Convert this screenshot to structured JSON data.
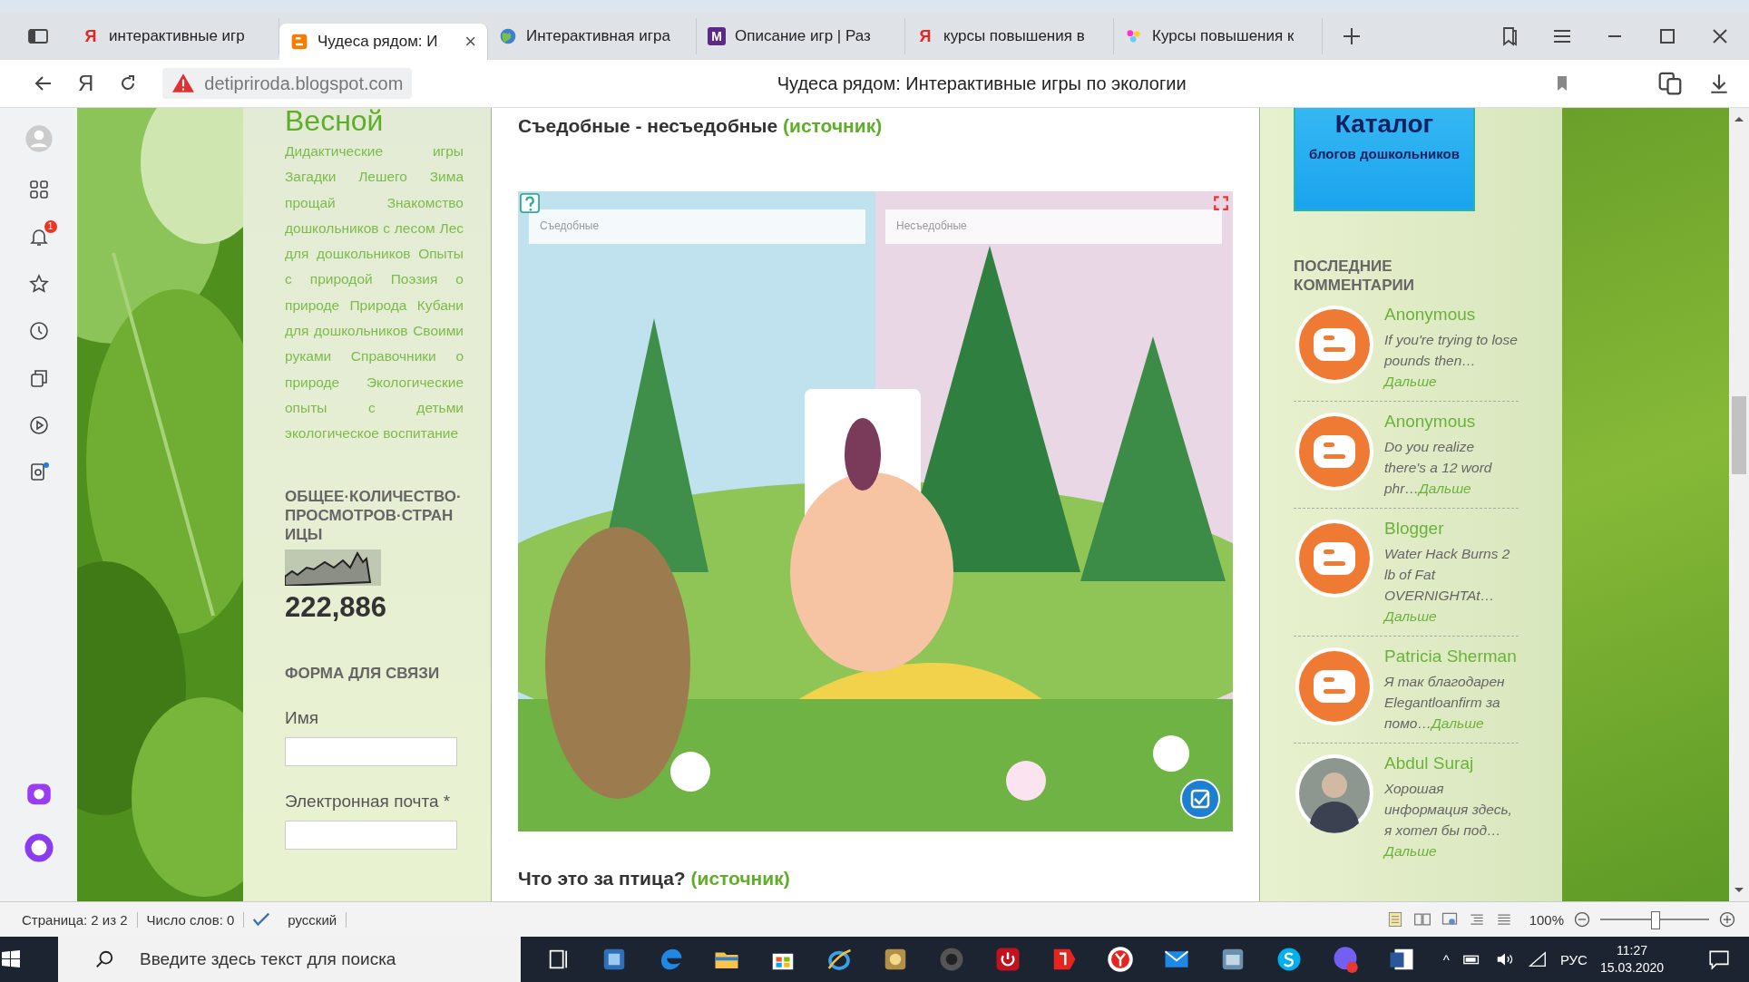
{
  "browser": {
    "tabs": [
      {
        "title": "интерактивные игр",
        "favicon": {
          "kind": "letter",
          "text": "Я",
          "color": "#e52620"
        },
        "selected": false
      },
      {
        "title": "Чудеса рядом: И",
        "favicon": {
          "kind": "blogger"
        },
        "selected": true
      },
      {
        "title": "Интерактивная игра",
        "favicon": {
          "kind": "globe"
        },
        "selected": false
      },
      {
        "title": "Описание игр | Раз",
        "favicon": {
          "kind": "tile",
          "text": "M",
          "color": "#5b2a86"
        },
        "selected": false
      },
      {
        "title": "курсы повышения в",
        "favicon": {
          "kind": "letter",
          "text": "Я",
          "color": "#e52620"
        },
        "selected": false
      },
      {
        "title": "Курсы повышения к",
        "favicon": {
          "kind": "flowers"
        },
        "selected": false
      }
    ],
    "tab_close": "×",
    "address_bar": {
      "home_button": "Я",
      "url": "detipriroda.blogspot.com",
      "page_title": "Чудеса рядом: Интерактивные игры по экологии"
    },
    "sidebar_badge": "1"
  },
  "left_column": {
    "title_tail": "Весной",
    "tags": "Дидактические игры Загадки Лешего Зима прощай Знакомство дошкольников с лесом Лес для дошкольников Опыты с природой Поэзия о природе Природа Кубани для дошкольников Своими руками Справочники о природе Экологические опыты с детьми экологическое воспитание",
    "stats_heading": "ОБЩЕЕ·КОЛИЧЕСТВО·ПРОСМОТРОВ·СТРАНИЦЫ",
    "views": "222,886",
    "form_heading": "ФОРМА ДЛЯ СВЯЗИ",
    "fields": [
      {
        "label": "Имя"
      },
      {
        "label": "Электронная почта *"
      }
    ]
  },
  "main": {
    "post_title": "Съедобные - несъедобные",
    "source_link": "(источник)",
    "game": {
      "zones": [
        "Съедобные",
        "Несъедобные"
      ]
    },
    "next_title": "Что это за птица?",
    "next_source_link": "(источник)"
  },
  "right_column": {
    "banner": {
      "title": "Каталог",
      "subtitle": "блогов дошкольников"
    },
    "comments_heading": "ПОСЛЕДНИЕ КОММЕНТАРИИ",
    "comments": [
      {
        "author": "Anonymous",
        "kind": "blogger",
        "text": "If you're trying to lose pounds then…",
        "more": "Дальше"
      },
      {
        "author": "Anonymous",
        "kind": "blogger",
        "text": "Do you realize there's a 12 word phr…",
        "more": "Дальше"
      },
      {
        "author": "Blogger",
        "kind": "blogger",
        "text": "Water Hack Burns 2 lb of Fat OVERNIGHTAt…",
        "more": "Дальше"
      },
      {
        "author": "Patricia Sherman",
        "kind": "blogger",
        "text": "Я так благодарен Elegantloanfirm за помо…",
        "more": "Дальше"
      },
      {
        "author": "Abdul Suraj",
        "text": "Хорошая информация здесь, я хотел бы под…",
        "more": "Дальше"
      }
    ]
  },
  "status_bar": {
    "page": "Страница: 2 из 2",
    "words": "Число слов: 0",
    "language": "русский",
    "zoom": "100%",
    "zoom_slider": {
      "level": 0.5
    }
  },
  "taskbar": {
    "search_placeholder": "Введите здесь текст для поиска",
    "language": "РУС",
    "time": "11:27",
    "date": "15.03.2020",
    "tray_caret": "^"
  }
}
